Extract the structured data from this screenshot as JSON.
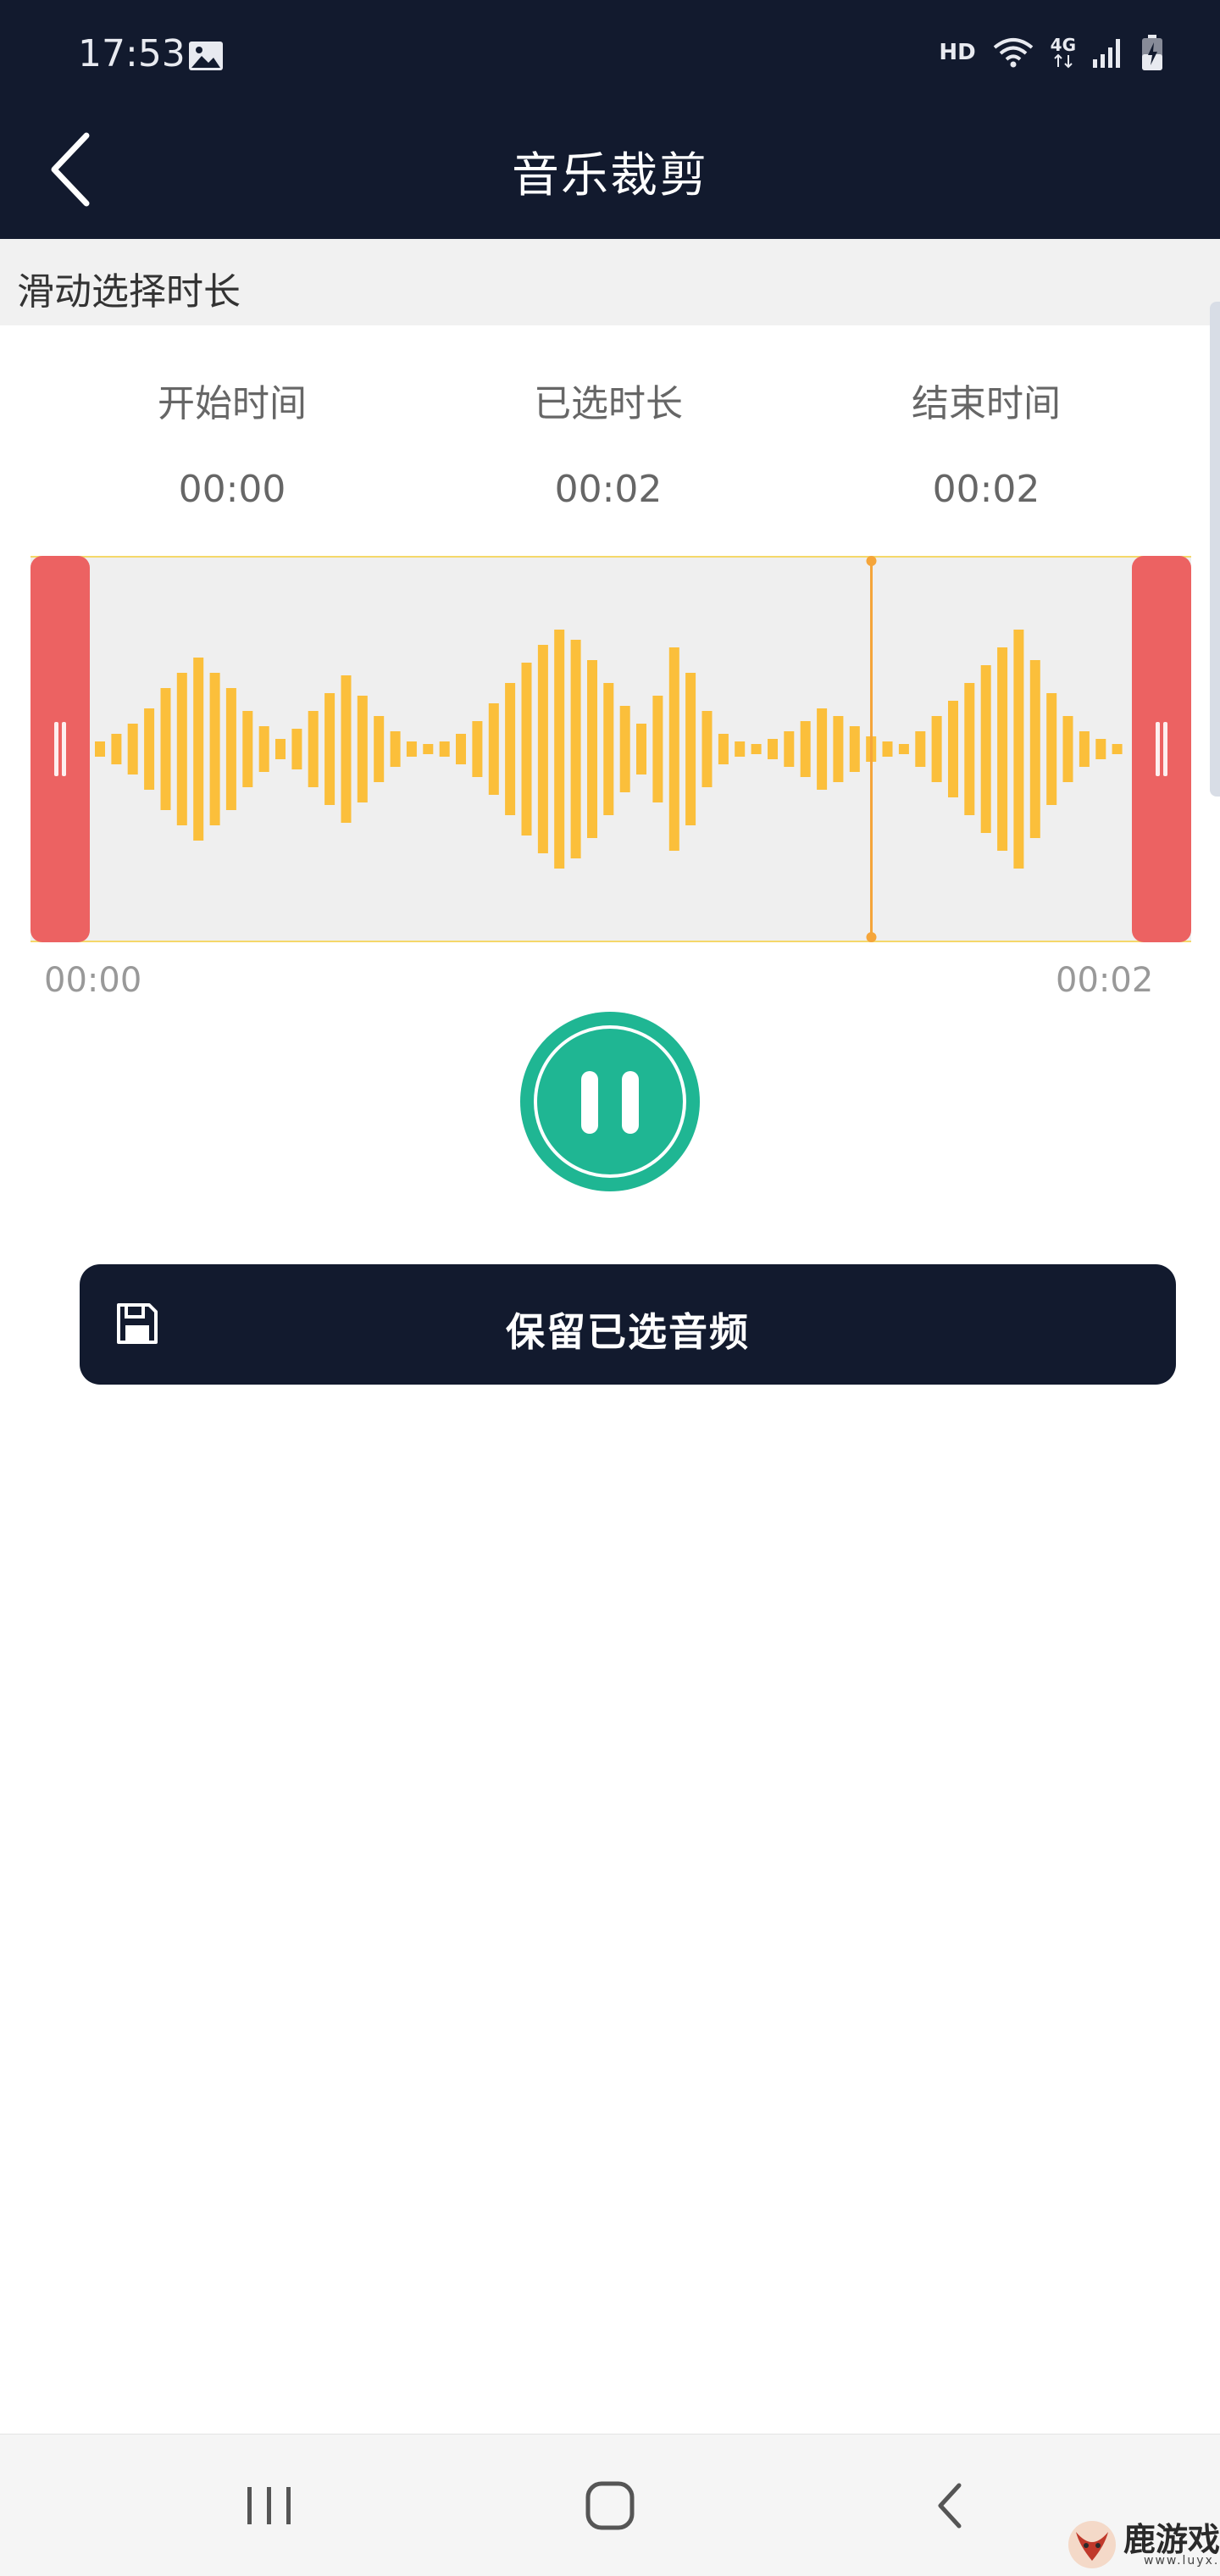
{
  "status_bar": {
    "time": "17:53",
    "gallery_icon": "image-icon",
    "hd": "HD",
    "network": "4G"
  },
  "header": {
    "title": "音乐裁剪",
    "back_icon": "chevron-left-icon"
  },
  "hint": "滑动选择时长",
  "info": {
    "start_label": "开始时间",
    "start_value": "00:00",
    "selected_label": "已选时长",
    "selected_value": "00:02",
    "end_label": "结束时间",
    "end_value": "00:02"
  },
  "waveform": {
    "start_time": "00:00",
    "end_time": "00:02",
    "playhead_fraction": 0.75,
    "bar_color": "#fbbf3b",
    "handle_color": "#ec6262",
    "amplitudes": [
      0.06,
      0.12,
      0.2,
      0.32,
      0.48,
      0.6,
      0.72,
      0.6,
      0.48,
      0.3,
      0.18,
      0.08,
      0.16,
      0.3,
      0.44,
      0.58,
      0.42,
      0.26,
      0.14,
      0.06,
      0.04,
      0.06,
      0.12,
      0.22,
      0.36,
      0.52,
      0.68,
      0.82,
      0.94,
      0.86,
      0.7,
      0.52,
      0.34,
      0.2,
      0.42,
      0.8,
      0.6,
      0.3,
      0.12,
      0.06,
      0.04,
      0.08,
      0.14,
      0.22,
      0.32,
      0.26,
      0.18,
      0.1,
      0.06,
      0.04,
      0.14,
      0.26,
      0.38,
      0.52,
      0.66,
      0.8,
      0.94,
      0.7,
      0.44,
      0.26,
      0.14,
      0.08,
      0.04
    ]
  },
  "controls": {
    "pause_icon": "pause-icon",
    "keep_label": "保留已选音频",
    "save_icon": "save-icon"
  },
  "colors": {
    "header_bg": "#121a2e",
    "accent_green": "#1fb693"
  },
  "nav": {
    "recents_icon": "recents-icon",
    "home_icon": "home-icon",
    "back_icon": "back-icon"
  },
  "watermark": {
    "name": "鹿游戏",
    "url": "www.luyx.cn"
  }
}
